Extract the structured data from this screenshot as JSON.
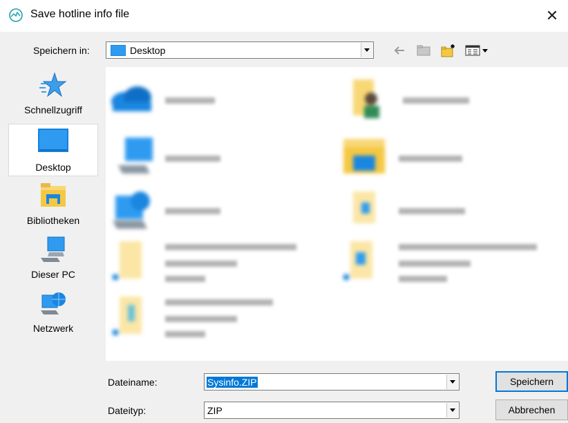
{
  "window": {
    "title": "Save hotline info file",
    "close_glyph": "✕"
  },
  "toolbar": {
    "save_in_label": "Speichern in:",
    "location": "Desktop",
    "icons": [
      "back-arrow-icon",
      "up-folder-icon",
      "new-folder-icon",
      "view-menu-icon"
    ]
  },
  "places": [
    {
      "label": "Schnellzugriff",
      "icon": "star-icon"
    },
    {
      "label": "Desktop",
      "icon": "desktop-icon",
      "selected": true
    },
    {
      "label": "Bibliotheken",
      "icon": "libraries-icon"
    },
    {
      "label": "Dieser PC",
      "icon": "computer-icon"
    },
    {
      "label": "Netzwerk",
      "icon": "network-icon"
    }
  ],
  "file_list": {
    "note": "",
    "items": [
      {
        "icon": "onedrive-icon"
      },
      {
        "icon": "user-folder-icon"
      },
      {
        "icon": "this-pc-icon"
      },
      {
        "icon": "libraries-folder-icon"
      },
      {
        "icon": "network-folder-icon"
      },
      {
        "icon": "shortcut-file-icon"
      },
      {
        "icon": "shortcut-file-icon"
      },
      {
        "icon": "shortcut-file-icon"
      },
      {
        "icon": "shortcut-file-icon"
      }
    ]
  },
  "form": {
    "filename_label": "Dateiname:",
    "filename_value": "Sysinfo.ZIP",
    "filetype_label": "Dateityp:",
    "filetype_value": "ZIP"
  },
  "buttons": {
    "save": "Speichern",
    "cancel": "Abbrechen"
  },
  "colors": {
    "accent": "#0078d7",
    "folder": "#f8d775"
  }
}
